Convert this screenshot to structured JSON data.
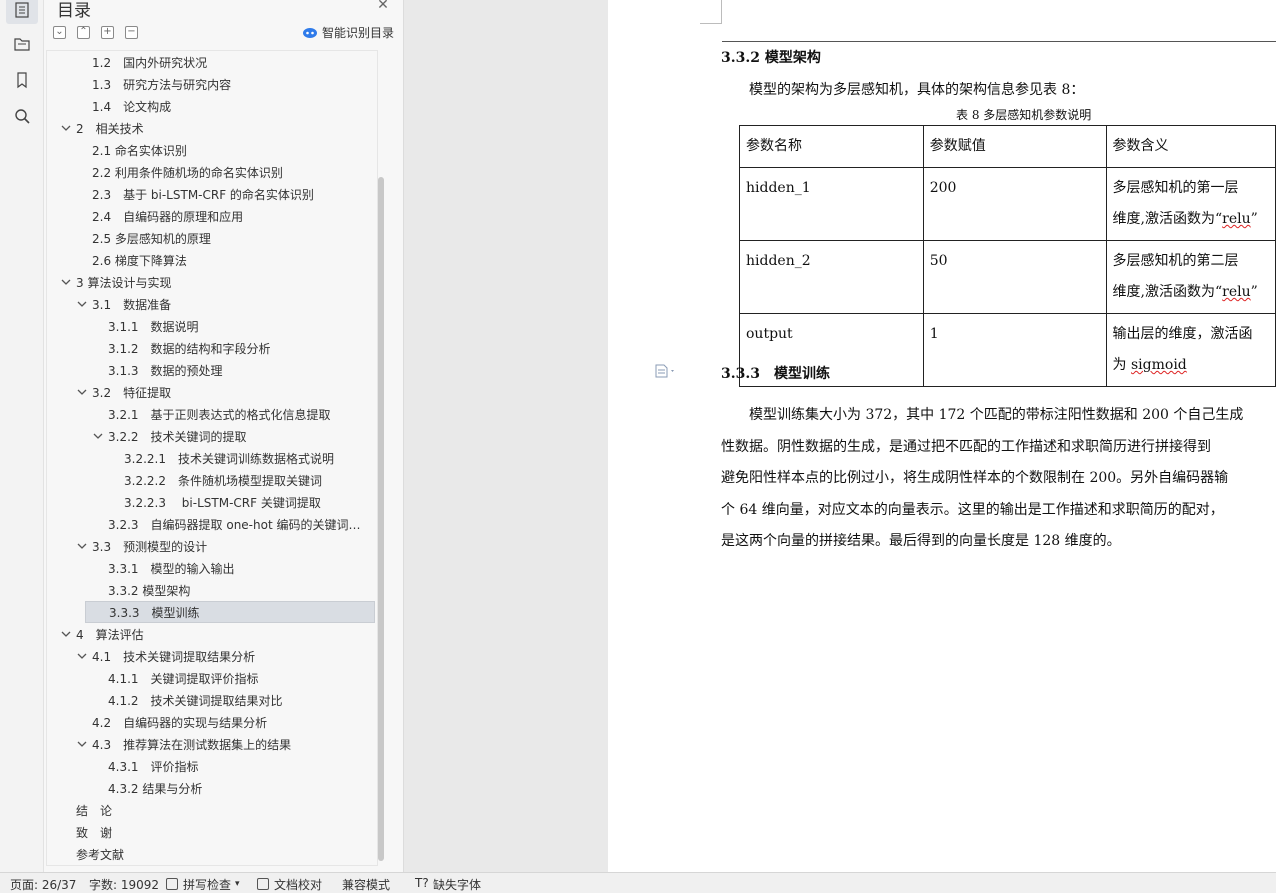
{
  "rail": {
    "icons": [
      "toc-icon",
      "folder-tree-icon",
      "bookmark-icon",
      "search-icon"
    ]
  },
  "toc": {
    "title": "目录",
    "smart_label": "智能识别目录",
    "tool_labels": [
      "⌄",
      "⌃",
      "+",
      "−"
    ],
    "items": [
      {
        "label": "1.2　国内外研究状况",
        "level": 2,
        "chev": "none"
      },
      {
        "label": "1.3　研究方法与研究内容",
        "level": 2,
        "chev": "none"
      },
      {
        "label": "1.4　论文构成",
        "level": 2,
        "chev": "none"
      },
      {
        "label": "2　相关技术",
        "level": 1,
        "chev": "down"
      },
      {
        "label": "2.1 命名实体识别",
        "level": 2,
        "chev": "none"
      },
      {
        "label": "2.2 利用条件随机场的命名实体识别",
        "level": 2,
        "chev": "none"
      },
      {
        "label": "2.3　基于 bi-LSTM-CRF 的命名实体识别",
        "level": 2,
        "chev": "none"
      },
      {
        "label": "2.4　自编码器的原理和应用",
        "level": 2,
        "chev": "none"
      },
      {
        "label": "2.5 多层感知机的原理",
        "level": 2,
        "chev": "none"
      },
      {
        "label": "2.6 梯度下降算法",
        "level": 2,
        "chev": "none"
      },
      {
        "label": "3 算法设计与实现",
        "level": 1,
        "chev": "down"
      },
      {
        "label": "3.1　数据准备",
        "level": 2,
        "chev": "down"
      },
      {
        "label": "3.1.1　数据说明",
        "level": 3,
        "chev": "none"
      },
      {
        "label": "3.1.2　数据的结构和字段分析",
        "level": 3,
        "chev": "none"
      },
      {
        "label": "3.1.3　数据的预处理",
        "level": 3,
        "chev": "none"
      },
      {
        "label": "3.2　特征提取",
        "level": 2,
        "chev": "down"
      },
      {
        "label": "3.2.1　基于正则表达式的格式化信息提取",
        "level": 3,
        "chev": "none"
      },
      {
        "label": "3.2.2　技术关键词的提取",
        "level": 3,
        "chev": "down"
      },
      {
        "label": "3.2.2.1　技术关键词训练数据格式说明",
        "level": 4,
        "chev": "none"
      },
      {
        "label": "3.2.2.2　条件随机场模型提取关键词",
        "level": 4,
        "chev": "none"
      },
      {
        "label": "3.2.2.3　 bi-LSTM-CRF 关键词提取",
        "level": 4,
        "chev": "none"
      },
      {
        "label": "3.2.3　自编码器提取 one-hot 编码的关键词特征",
        "level": 3,
        "chev": "none"
      },
      {
        "label": "3.3　预测模型的设计",
        "level": 2,
        "chev": "down"
      },
      {
        "label": "3.3.1　模型的输入输出",
        "level": 3,
        "chev": "none"
      },
      {
        "label": "3.3.2 模型架构",
        "level": 3,
        "chev": "none"
      },
      {
        "label": "3.3.3　模型训练",
        "level": 3,
        "chev": "none",
        "selected": true
      },
      {
        "label": "4　算法评估",
        "level": 1,
        "chev": "down"
      },
      {
        "label": "4.1　技术关键词提取结果分析",
        "level": 2,
        "chev": "down"
      },
      {
        "label": "4.1.1　关键词提取评价指标",
        "level": 3,
        "chev": "none"
      },
      {
        "label": "4.1.2　技术关键词提取结果对比",
        "level": 3,
        "chev": "none"
      },
      {
        "label": "4.2　自编码器的实现与结果分析",
        "level": 2,
        "chev": "none"
      },
      {
        "label": "4.3　推荐算法在测试数据集上的结果",
        "level": 2,
        "chev": "down"
      },
      {
        "label": "4.3.1　评价指标",
        "level": 3,
        "chev": "none"
      },
      {
        "label": "4.3.2 结果与分析",
        "level": 3,
        "chev": "none"
      },
      {
        "label": "结　论",
        "level": 0,
        "chev": "none"
      },
      {
        "label": "致　谢",
        "level": 0,
        "chev": "none"
      },
      {
        "label": "参考文献",
        "level": 0,
        "chev": "none"
      }
    ]
  },
  "document": {
    "section_332": "3.3.2  模型架构",
    "intro": "模型的架构为多层感知机，具体的架构信息参见表 8：",
    "caption": "表 8  多层感知机参数说明",
    "table": {
      "headers": [
        "参数名称",
        "参数赋值",
        "参数含义"
      ],
      "rows": [
        {
          "name": "hidden_1",
          "value": "200",
          "meaning_1": "多层感知机的第一层",
          "meaning_2_pre": "维度,激活函数为“",
          "meaning_2_wavy": "relu",
          "meaning_2_post": "”"
        },
        {
          "name": "hidden_2",
          "value": "50",
          "meaning_1": "多层感知机的第二层",
          "meaning_2_pre": "维度,激活函数为“",
          "meaning_2_wavy": "relu",
          "meaning_2_post": "”"
        },
        {
          "name": "output",
          "value": "1",
          "meaning_1": "输出层的维度，激活函",
          "meaning_2_pre": "为 ",
          "meaning_2_wavy": "sigmoid",
          "meaning_2_post": ""
        }
      ]
    },
    "section_333": "3.3.3　模型训练",
    "body_lines": [
      "　　模型训练集大小为 372，其中 172 个匹配的带标注阳性数据和 200 个自己生成",
      "性数据。阴性数据的生成，是通过把不匹配的工作描述和求职简历进行拼接得到",
      "避免阳性样本点的比例过小，将生成阴性样本的个数限制在 200。另外自编码器输",
      "个 64 维向量，对应文本的向量表示。这里的输出是工作描述和求职简历的配对，",
      "是这两个向量的拼接结果。最后得到的向量长度是 128 维度的。"
    ]
  },
  "status": {
    "page": "页面: 26/37",
    "words": "字数: 19092",
    "spell": "拼写检查",
    "proof": "文档校对",
    "compat": "兼容模式",
    "missing_font": "缺失字体"
  }
}
